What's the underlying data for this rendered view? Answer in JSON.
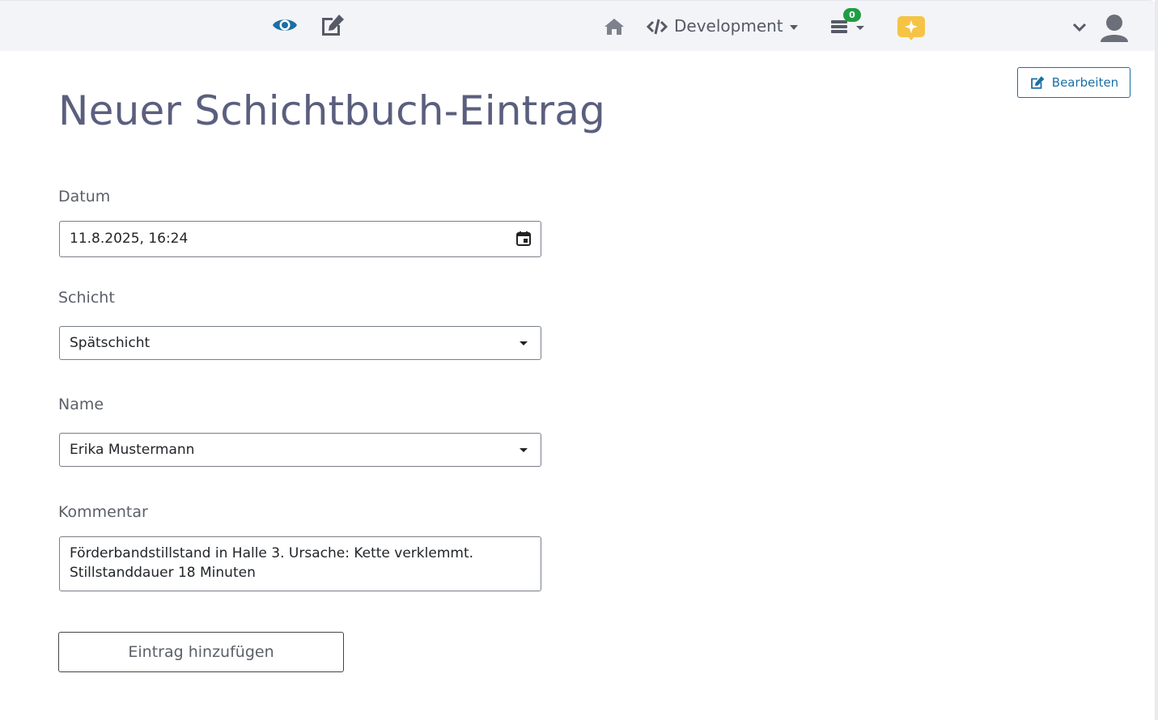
{
  "navbar": {
    "view_icon": "eye-icon",
    "edit_icon": "edit-icon",
    "home_icon": "home-icon",
    "code_icon": "code-icon",
    "environment_label": "Development",
    "queue_icon": "server-stack-icon",
    "queue_badge_count": "0",
    "ai_icon": "sparkle-chat-icon",
    "user_menu_icon": "chevron-down-icon",
    "avatar_icon": "user-avatar-icon",
    "accent_color": "#1b6fa6",
    "ai_icon_color": "#f6c445",
    "badge_color": "#1f9d45"
  },
  "page": {
    "title": "Neuer Schichtbuch-Eintrag",
    "edit_button_label": "Bearbeiten"
  },
  "form": {
    "date": {
      "label": "Datum",
      "value": "11.8.2025, 16:24"
    },
    "shift": {
      "label": "Schicht",
      "value": "Spätschicht"
    },
    "name": {
      "label": "Name",
      "value": "Erika Mustermann"
    },
    "comment": {
      "label": "Kommentar",
      "value": "Förderbandstillstand in Halle 3. Ursache: Kette verklemmt. Stillstanddauer 18 Minuten"
    },
    "submit_label": "Eintrag hinzufügen"
  }
}
